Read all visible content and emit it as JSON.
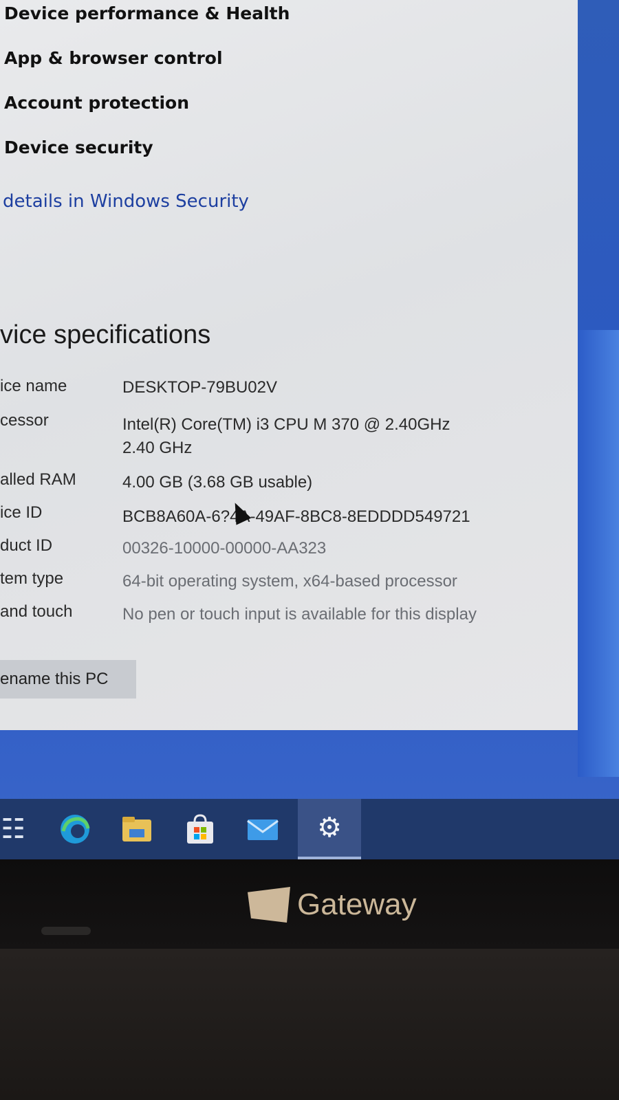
{
  "security_links": [
    "Device performance & Health",
    "App & browser control",
    "Account protection",
    "Device security"
  ],
  "details_link": "details in Windows Security",
  "section_title": "vice specifications",
  "specs": {
    "device_name": {
      "label": "ice name",
      "value": "DESKTOP-79BU02V"
    },
    "processor": {
      "label": "cessor",
      "value": "Intel(R) Core(TM) i3 CPU       M 370  @ 2.40GHz",
      "value2": "2.40 GHz"
    },
    "ram": {
      "label": "alled RAM",
      "value": "4.00 GB (3.68 GB usable)"
    },
    "device_id": {
      "label": "ice ID",
      "value": "BCB8A60A-6?4A-49AF-8BC8-8EDDDD549721"
    },
    "product_id": {
      "label": "duct ID",
      "value": "00326-10000-00000-AA323"
    },
    "system_type": {
      "label": "tem type",
      "value": "64-bit operating system, x64-based processor"
    },
    "pen_touch": {
      "label": "and touch",
      "value": "No pen or touch input is available for this display"
    }
  },
  "rename_button": "ename this PC",
  "taskbar": {
    "icons": [
      "task-view",
      "edge",
      "file-explorer",
      "store",
      "mail",
      "settings"
    ],
    "active": "settings"
  },
  "brand": "Gateway",
  "colors": {
    "window_bg": "#e3e4e6",
    "link_blue": "#1d3fa0",
    "desktop_blue": "#2f5db8",
    "taskbar": "#20396a",
    "brand_gold": "#cbb799"
  }
}
